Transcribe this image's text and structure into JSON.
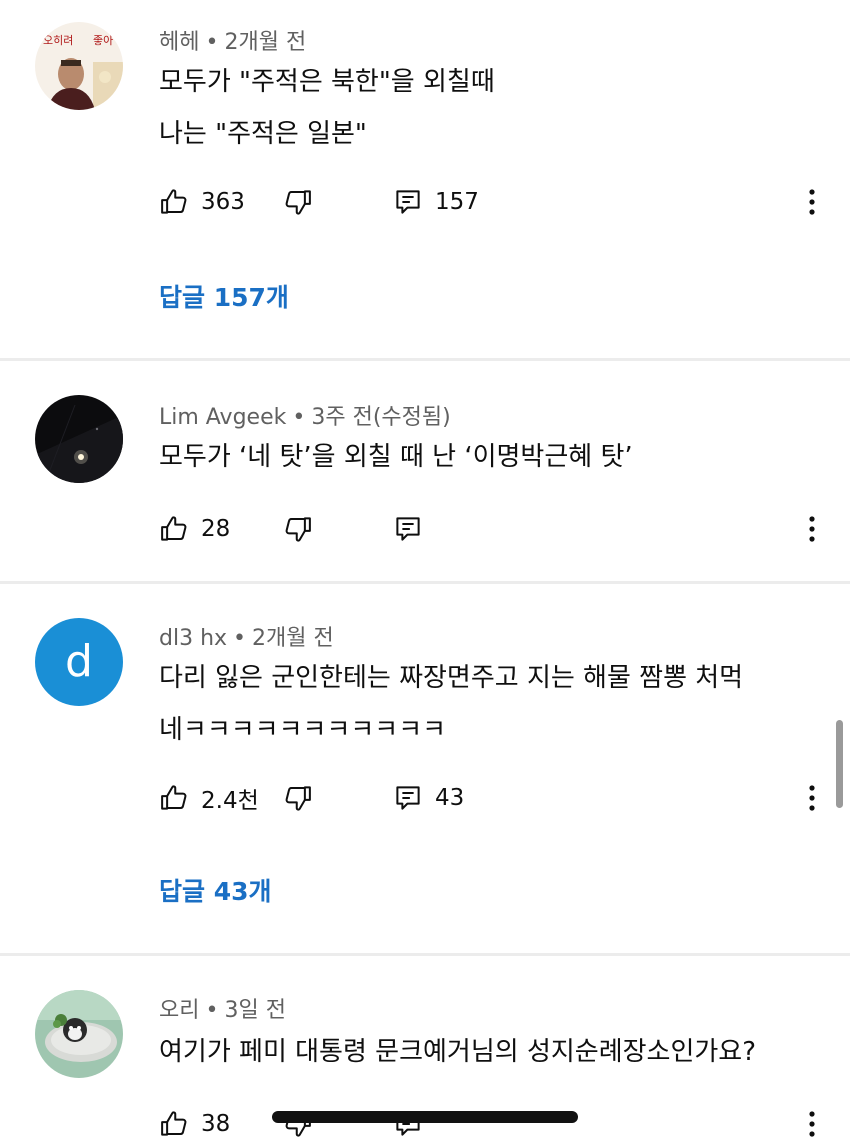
{
  "comments": [
    {
      "author": "헤헤",
      "time": "2개월 전",
      "lines": [
        "모두가 \"주적은 북한\"을 외칠때",
        "나는 \"주적은 일본\""
      ],
      "likes": "363",
      "reply_count": "157",
      "replies_link": "답글 157개",
      "avatar_text": [
        "오히려",
        "좋아"
      ]
    },
    {
      "author": "Lim Avgeek",
      "time": "3주 전(수정됨)",
      "lines": [
        "모두가 ‘네 탓’을 외칠 때 난 ‘이명박근혜 탓’"
      ],
      "likes": "28"
    },
    {
      "author": "dl3 hx",
      "time": "2개월 전",
      "lines": [
        "다리 잃은 군인한테는 짜장면주고 지는 해물 짬뽕 처먹",
        "네ㅋㅋㅋㅋㅋㅋㅋㅋㅋㅋㅋ"
      ],
      "likes": "2.4천",
      "reply_count": "43",
      "replies_link": "답글 43개",
      "avatar_letter": "d",
      "avatar_color": "#1a8fd6"
    },
    {
      "author": "오리",
      "time": "3일 전",
      "lines": [
        "여기가 페미 대통령 문크예거님의 성지순례장소인가요?"
      ],
      "likes": "38"
    }
  ],
  "icons": {
    "like": "thumbs-up-icon",
    "dislike": "thumbs-down-icon",
    "reply": "reply-comment-icon",
    "more": "more-vert-icon"
  },
  "colors": {
    "link": "#1a6fc4",
    "meta": "#606060",
    "divider": "#ececec"
  }
}
